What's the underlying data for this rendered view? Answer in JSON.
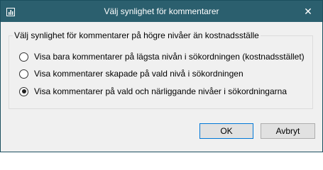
{
  "window": {
    "title": "Välj synlighet för kommentarer",
    "app_icon": "chart-icon",
    "close_glyph": "✕"
  },
  "group": {
    "legend": "Välj synlighet för kommentarer på högre nivåer än kostnadsställe",
    "options": [
      {
        "label": "Visa bara kommentarer på lägsta nivån i sökordningen (kostnadsstället)",
        "selected": false
      },
      {
        "label": "Visa kommentarer skapade på vald nivå i sökordningen",
        "selected": false
      },
      {
        "label": "Visa kommentarer på vald och närliggande nivåer i sökordningarna",
        "selected": true
      }
    ]
  },
  "buttons": {
    "ok_label": "OK",
    "cancel_label": "Avbryt"
  },
  "colors": {
    "titlebar": "#2b5f6e",
    "default_button_border": "#0078d7"
  }
}
